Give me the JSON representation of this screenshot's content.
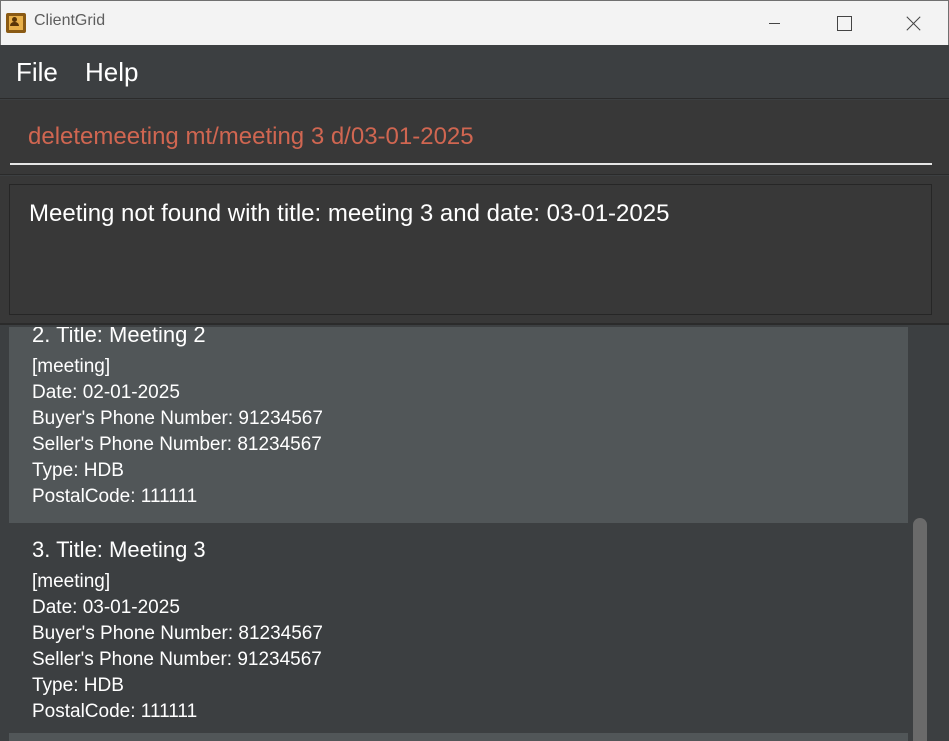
{
  "window": {
    "title": "ClientGrid",
    "icon": "address-book-icon"
  },
  "menu": {
    "file": "File",
    "help": "Help"
  },
  "command": {
    "value": "deletemeeting mt/meeting 3 d/03-01-2025",
    "text_color": "#d06651"
  },
  "result": {
    "message": "Meeting not found with title: meeting 3 and date: 03-01-2025"
  },
  "meetings": [
    {
      "title": "2. Title: Meeting 2",
      "tag": "[meeting]",
      "date": "Date: 02-01-2025",
      "buyer_phone": "Buyer's Phone Number: 91234567",
      "seller_phone": "Seller's Phone Number: 81234567",
      "type": "Type: HDB",
      "postal": "PostalCode: 111111"
    },
    {
      "title": "3. Title: Meeting 3",
      "tag": "[meeting]",
      "date": "Date: 03-01-2025",
      "buyer_phone": "Buyer's Phone Number: 81234567",
      "seller_phone": "Seller's Phone Number: 91234567",
      "type": "Type: HDB",
      "postal": "PostalCode: 111111"
    }
  ],
  "colors": {
    "background": "#3c3f41",
    "card_selected": "#515658",
    "text": "#ffffff"
  }
}
